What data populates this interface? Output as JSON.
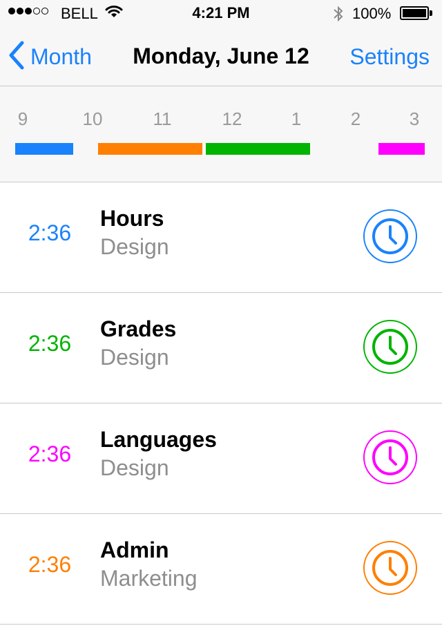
{
  "status_bar": {
    "carrier": "BELL",
    "time": "4:21 PM",
    "battery": "100%",
    "signal_icons": [
      "signal-dot-full",
      "signal-dot-full",
      "signal-dot-full",
      "signal-dot-empty",
      "signal-dot-empty"
    ]
  },
  "nav": {
    "back_label": "Month",
    "title": "Monday, June 12",
    "settings_label": "Settings",
    "accent": "#1a82fb"
  },
  "timeline": {
    "hours": [
      "9",
      "10",
      "11",
      "12",
      "1",
      "2",
      "3"
    ],
    "blocks": [
      {
        "color": "#1a82fb",
        "start": 9.0,
        "end": 10.0
      },
      {
        "color": "#ff7f00",
        "start": 10.1,
        "end": 11.8
      },
      {
        "color": "#00b400",
        "start": 11.85,
        "end": 13.2
      },
      {
        "color": "#ff00ff",
        "start": 14.4,
        "end": 15.2
      }
    ]
  },
  "entries": [
    {
      "duration": "2:36",
      "title": "Hours",
      "subtitle": "Design",
      "color": "#1a82fb",
      "icon": "clock-icon"
    },
    {
      "duration": "2:36",
      "title": "Grades",
      "subtitle": "Design",
      "color": "#00b400",
      "icon": "clock-icon"
    },
    {
      "duration": "2:36",
      "title": "Languages",
      "subtitle": "Design",
      "color": "#ff00ff",
      "icon": "clock-icon"
    },
    {
      "duration": "2:36",
      "title": "Admin",
      "subtitle": "Marketing",
      "color": "#ff7f00",
      "icon": "clock-icon"
    }
  ]
}
